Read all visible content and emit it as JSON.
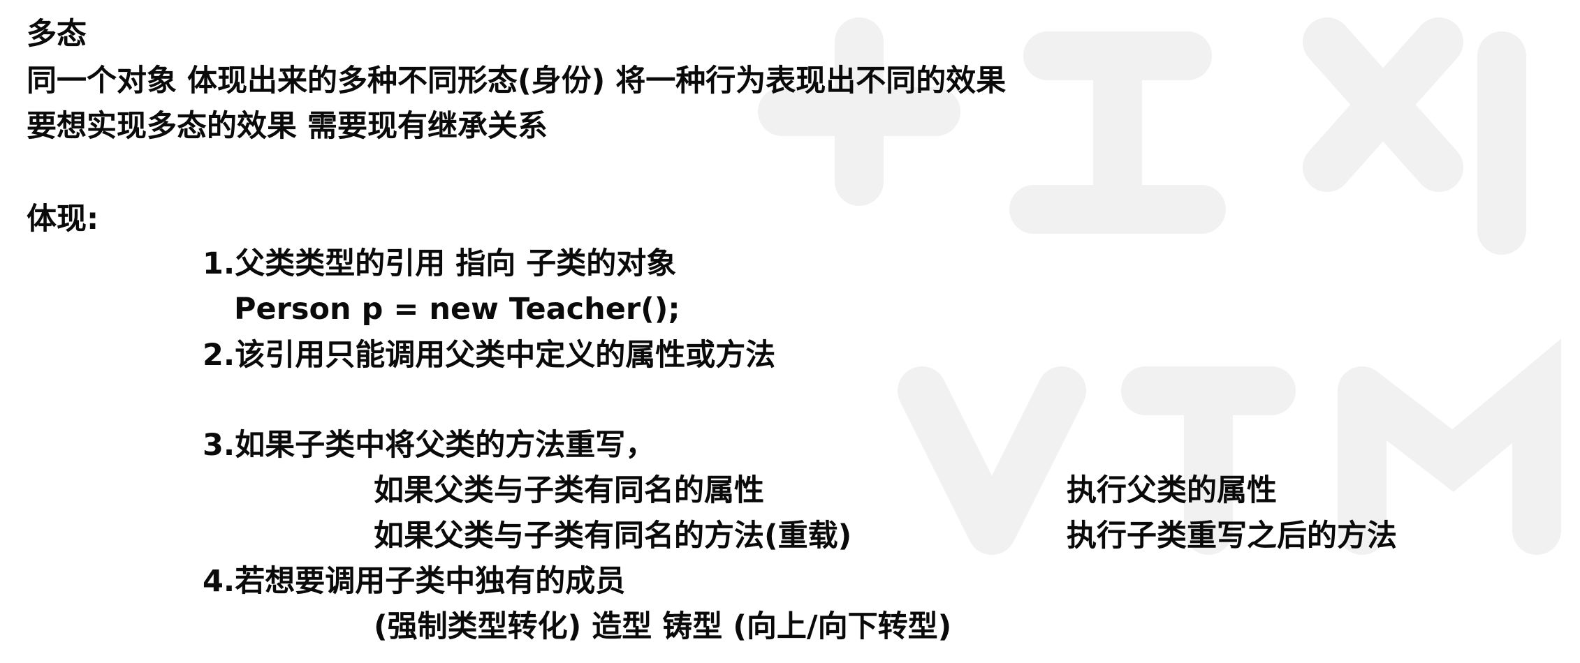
{
  "title": "多态",
  "definition": "同一个对象 体现出来的多种不同形态(身份)  将一种行为表现出不同的效果",
  "requirement": "要想实现多态的效果 需要现有继承关系",
  "section_label": "体现:",
  "point1": "1.父类类型的引用   指向   子类的对象",
  "code": "Person p = new Teacher();",
  "point2": "2.该引用只能调用父类中定义的属性或方法",
  "point3": "3.如果子类中将父类的方法重写，",
  "case_field_condition": "如果父类与子类有同名的属性",
  "case_field_result": "执行父类的属性",
  "case_method_condition": "如果父类与子类有同名的方法(重载)",
  "case_method_result": "执行子类重写之后的方法",
  "point4": "4.若想要调用子类中独有的成员",
  "point4_detail": "(强制类型转化)  造型  铸型  (向上/向下转型)"
}
